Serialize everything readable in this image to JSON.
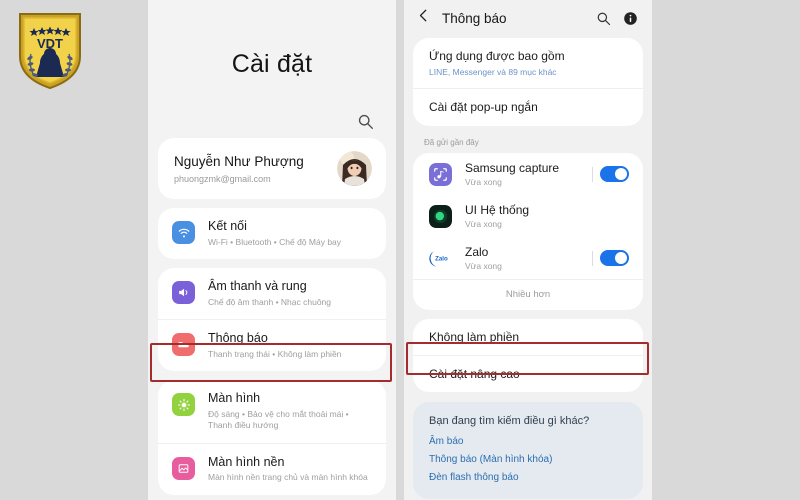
{
  "watermark": {
    "name": "vdt-shield-logo",
    "text": "VDT"
  },
  "left_panel": {
    "title": "Cài đặt",
    "search_icon": "search-icon",
    "account": {
      "name": "Nguyễn Như Phượng",
      "email": "phuongzmk@gmail.com",
      "avatar": "user-avatar"
    },
    "items": [
      {
        "icon": "wifi-icon",
        "color": "#4a90e2",
        "title": "Kết nối",
        "subtitle": "Wi-Fi • Bluetooth • Chế độ Máy bay",
        "highlighted": false
      },
      {
        "icon": "speaker-icon",
        "color": "#7b61d9",
        "title": "Âm thanh và rung",
        "subtitle": "Chế độ âm thanh • Nhạc chuông",
        "highlighted": false
      },
      {
        "icon": "notification-icon",
        "color": "#ef6d6d",
        "title": "Thông báo",
        "subtitle": "Thanh trạng thái • Không làm phiền",
        "highlighted": true
      },
      {
        "icon": "brightness-icon",
        "color": "#93d23f",
        "title": "Màn hình",
        "subtitle": "Độ sáng • Bảo vệ cho mắt thoải mái • Thanh điều hướng",
        "highlighted": false
      },
      {
        "icon": "wallpaper-icon",
        "color": "#e75d9e",
        "title": "Màn hình nền",
        "subtitle": "Màn hình nền trang chủ và màn hình khóa",
        "highlighted": false
      }
    ]
  },
  "right_panel": {
    "header": {
      "back_icon": "chevron-left-icon",
      "title": "Thông báo",
      "search_icon": "search-icon",
      "info_icon": "info-icon"
    },
    "top_card": [
      {
        "title": "Ứng dụng được bao gồm",
        "subtitle": "LINE, Messenger và 89 mục khác"
      },
      {
        "title": "Cài đặt pop-up ngắn",
        "subtitle": ""
      }
    ],
    "recent_label": "Đã gửi gần đây",
    "recent_apps": [
      {
        "icon": "samsung-capture-icon",
        "name": "Samsung capture",
        "status": "Vừa xong",
        "toggle": true,
        "has_toggle": true
      },
      {
        "icon": "system-ui-icon",
        "name": "UI Hệ thống",
        "status": "Vừa xong",
        "toggle": false,
        "has_toggle": false
      },
      {
        "icon": "zalo-icon",
        "name": "Zalo",
        "status": "Vừa xong",
        "toggle": true,
        "has_toggle": true
      }
    ],
    "more_label": "Nhiều hơn",
    "bottom_rows": [
      {
        "title": "Không làm phiền",
        "highlighted": false
      },
      {
        "title": "Cài đặt nâng cao",
        "highlighted": true
      }
    ],
    "looking_for": {
      "title": "Bạn đang tìm kiếm điều gì khác?",
      "links": [
        "Âm báo",
        "Thông báo (Màn hình khóa)",
        "Đèn flash thông báo"
      ]
    }
  },
  "colors": {
    "page_background": "#d9d9d9",
    "panel_background": "#f3f3f3",
    "card_background": "#ffffff",
    "highlight_border": "#a62c2c",
    "toggle_on": "#1a73e8",
    "link_blue": "#2a6fb0",
    "looking_card": "#e5e9f0"
  }
}
